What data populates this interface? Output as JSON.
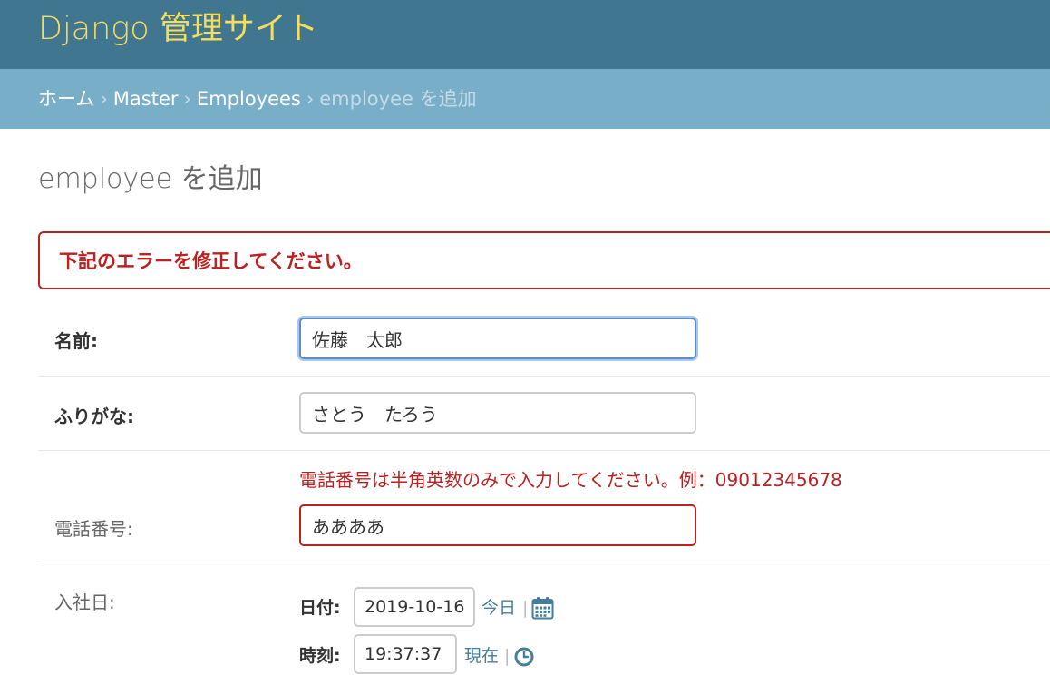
{
  "header": {
    "site_name": "Django 管理サイト"
  },
  "breadcrumbs": {
    "items": [
      {
        "label": "ホーム"
      },
      {
        "label": "Master"
      },
      {
        "label": "Employees"
      },
      {
        "label": "employee を追加"
      }
    ],
    "separator": "›"
  },
  "page": {
    "title": "employee を追加"
  },
  "errornote": {
    "text": "下記のエラーを修正してください。"
  },
  "form": {
    "name": {
      "label": "名前:",
      "value": "佐藤　太郎"
    },
    "furigana": {
      "label": "ふりがな:",
      "value": "さとう　たろう"
    },
    "phone": {
      "label": "電話番号:",
      "error": "電話番号は半角英数のみで入力してください。例：09012345678",
      "value": "ああああ"
    },
    "hire_date": {
      "label": "入社日:",
      "date_label": "日付:",
      "date_value": "2019-10-16",
      "today_link": "今日",
      "time_label": "時刻:",
      "time_value": "19:37:37",
      "now_link": "現在",
      "separator": "|"
    }
  },
  "colors": {
    "header_bg": "#417690",
    "branding": "#f5dd5d",
    "breadcrumbs_bg": "#79aec8",
    "error": "#ba2121",
    "link": "#447e9b"
  },
  "icons": {
    "calendar": "calendar-icon",
    "clock": "clock-icon"
  }
}
